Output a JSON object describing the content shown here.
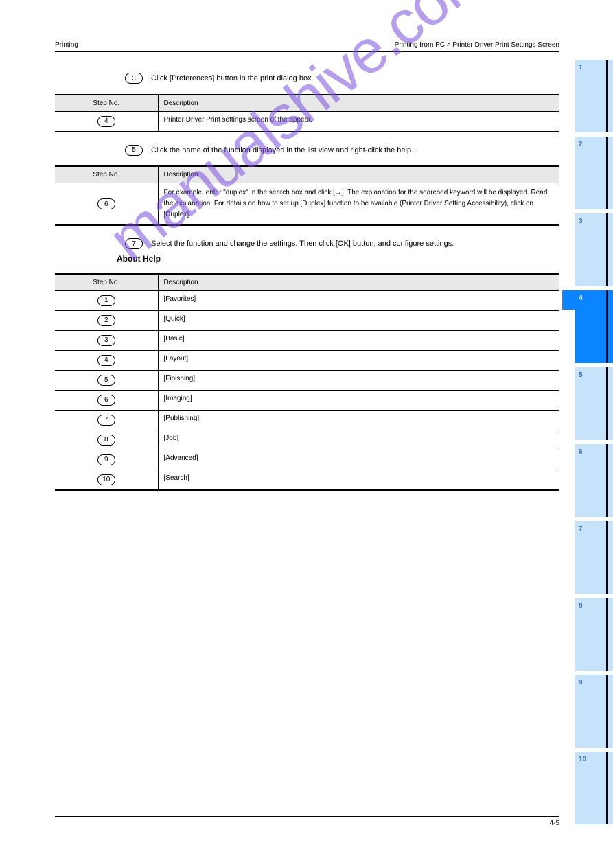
{
  "header": {
    "left": "Printing",
    "right": "Printing from PC > Printer Driver Print Settings Screen"
  },
  "step3": {
    "num": "3",
    "text": "Click [Preferences] button in the print dialog box."
  },
  "table3": {
    "h1": "Step No.",
    "h2": "Description",
    "row_num": "4",
    "row_txt": "Printer Driver Print settings screen of the appear."
  },
  "step5": {
    "num": "5",
    "text": "Click the name of the function displayed in the list view and right-click the help."
  },
  "table5": {
    "h1": "Step No.",
    "h2": "Description",
    "row_num": "6",
    "row_txt": "For example, enter \"duplex\" in the search box and click [→]. The explanation for the searched keyword will be displayed. Read the explanation. For details on how to set up [Duplex] function to be available (Printer Driver Setting Accessibility), click on [Duplex]."
  },
  "step7": {
    "num": "7",
    "text": "Select the function and change the settings. Then click [OK] button, and configure settings."
  },
  "subheading": "About Help",
  "table7": {
    "h1": "Step No.",
    "h2": "Description",
    "rows": [
      {
        "num": "1",
        "txt": "[Favorites]"
      },
      {
        "num": "2",
        "txt": "[Quick]"
      },
      {
        "num": "3",
        "txt": "[Basic]"
      },
      {
        "num": "4",
        "txt": "[Layout]"
      },
      {
        "num": "5",
        "txt": "[Finishing]"
      },
      {
        "num": "6",
        "txt": "[Imaging]"
      },
      {
        "num": "7",
        "txt": "[Publishing]"
      },
      {
        "num": "8",
        "txt": "[Job]"
      },
      {
        "num": "9",
        "txt": "[Advanced]"
      },
      {
        "num": "10",
        "txt": "[Search]"
      }
    ]
  },
  "sidebar": {
    "tabs": [
      "1",
      "2",
      "3",
      "4",
      "5",
      "6",
      "7",
      "8",
      "9",
      "10"
    ],
    "active_index": 3
  },
  "footer": "4-5",
  "watermark": "manualshive.com"
}
